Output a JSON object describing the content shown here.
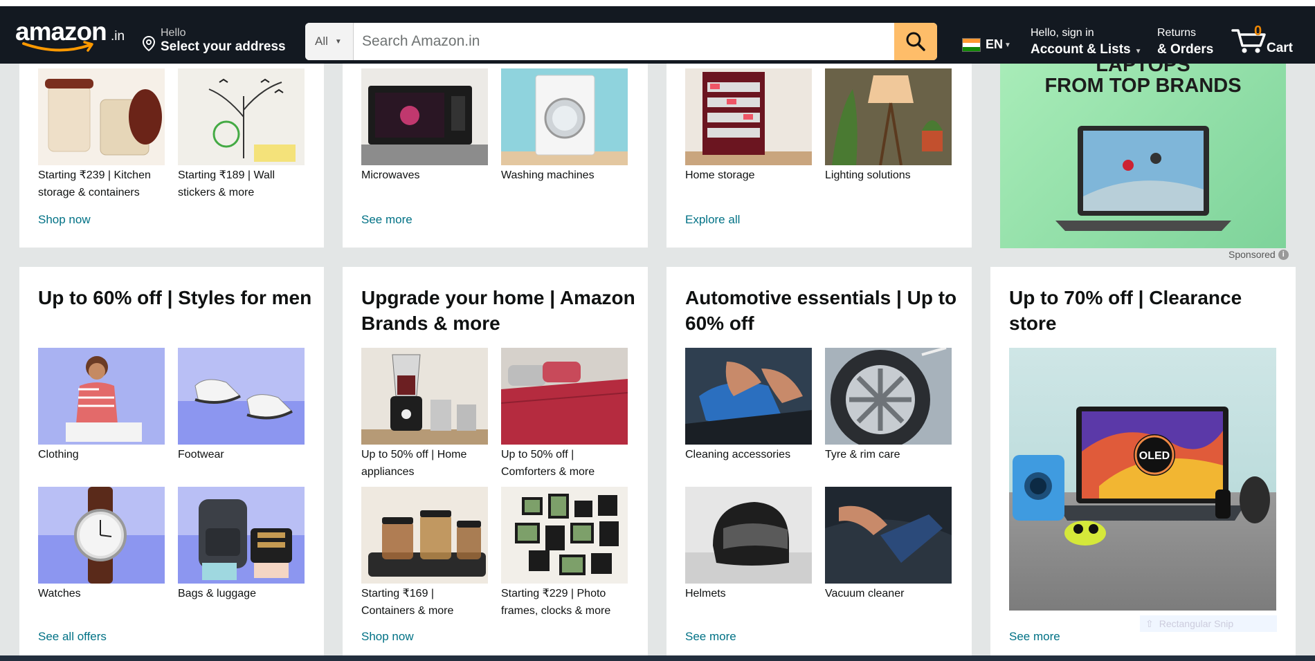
{
  "header": {
    "logo": "amazon",
    "logo_suffix": ".in",
    "address_hello": "Hello",
    "address_main": "Select your address",
    "search_category": "All",
    "search_placeholder": "Search Amazon.in",
    "language": "EN",
    "account_line1": "Hello, sign in",
    "account_line2": "Account & Lists",
    "returns_line1": "Returns",
    "returns_line2": "& Orders",
    "cart_count": "0",
    "cart_label": "Cart"
  },
  "row1": {
    "card1": {
      "tiles": [
        {
          "label": "Starting ₹239 | Kitchen storage & containers"
        },
        {
          "label": "Starting ₹189 | Wall stickers & more"
        }
      ],
      "link": "Shop now"
    },
    "card2": {
      "tiles": [
        {
          "label": "Microwaves"
        },
        {
          "label": "Washing machines"
        }
      ],
      "link": "See more"
    },
    "card3": {
      "tiles": [
        {
          "label": "Home storage"
        },
        {
          "label": "Lighting solutions"
        }
      ],
      "link": "Explore all"
    },
    "ad": {
      "line1": "LAPTOPS",
      "line2": "FROM TOP BRANDS",
      "sponsored": "Sponsored"
    }
  },
  "row2": {
    "card1": {
      "title": "Up to 60% off | Styles for men",
      "tiles": [
        {
          "label": "Clothing"
        },
        {
          "label": "Footwear"
        },
        {
          "label": "Watches"
        },
        {
          "label": "Bags & luggage"
        }
      ],
      "link": "See all offers"
    },
    "card2": {
      "title": "Upgrade your home | Amazon Brands & more",
      "tiles": [
        {
          "label": "Up to 50% off | Home appliances"
        },
        {
          "label": "Up to 50% off | Comforters & more"
        },
        {
          "label": "Starting ₹169 | Containers & more"
        },
        {
          "label": "Starting ₹229 | Photo frames, clocks & more"
        }
      ],
      "link": "Shop now"
    },
    "card3": {
      "title": "Automotive essentials | Up to 60% off",
      "tiles": [
        {
          "label": "Cleaning accessories"
        },
        {
          "label": "Tyre & rim care"
        },
        {
          "label": "Helmets"
        },
        {
          "label": "Vacuum cleaner"
        }
      ],
      "link": "See more"
    },
    "card4": {
      "title": "Up to 70% off | Clearance store",
      "oled_badge": "OLED",
      "link": "See more"
    }
  },
  "overlay": {
    "snip_label": "Rectangular Snip"
  },
  "colors": {
    "header_bg": "#131921",
    "search_button": "#febd69",
    "link": "#007185",
    "cart_count": "#f08804",
    "page_bg": "#e3e6e6"
  }
}
